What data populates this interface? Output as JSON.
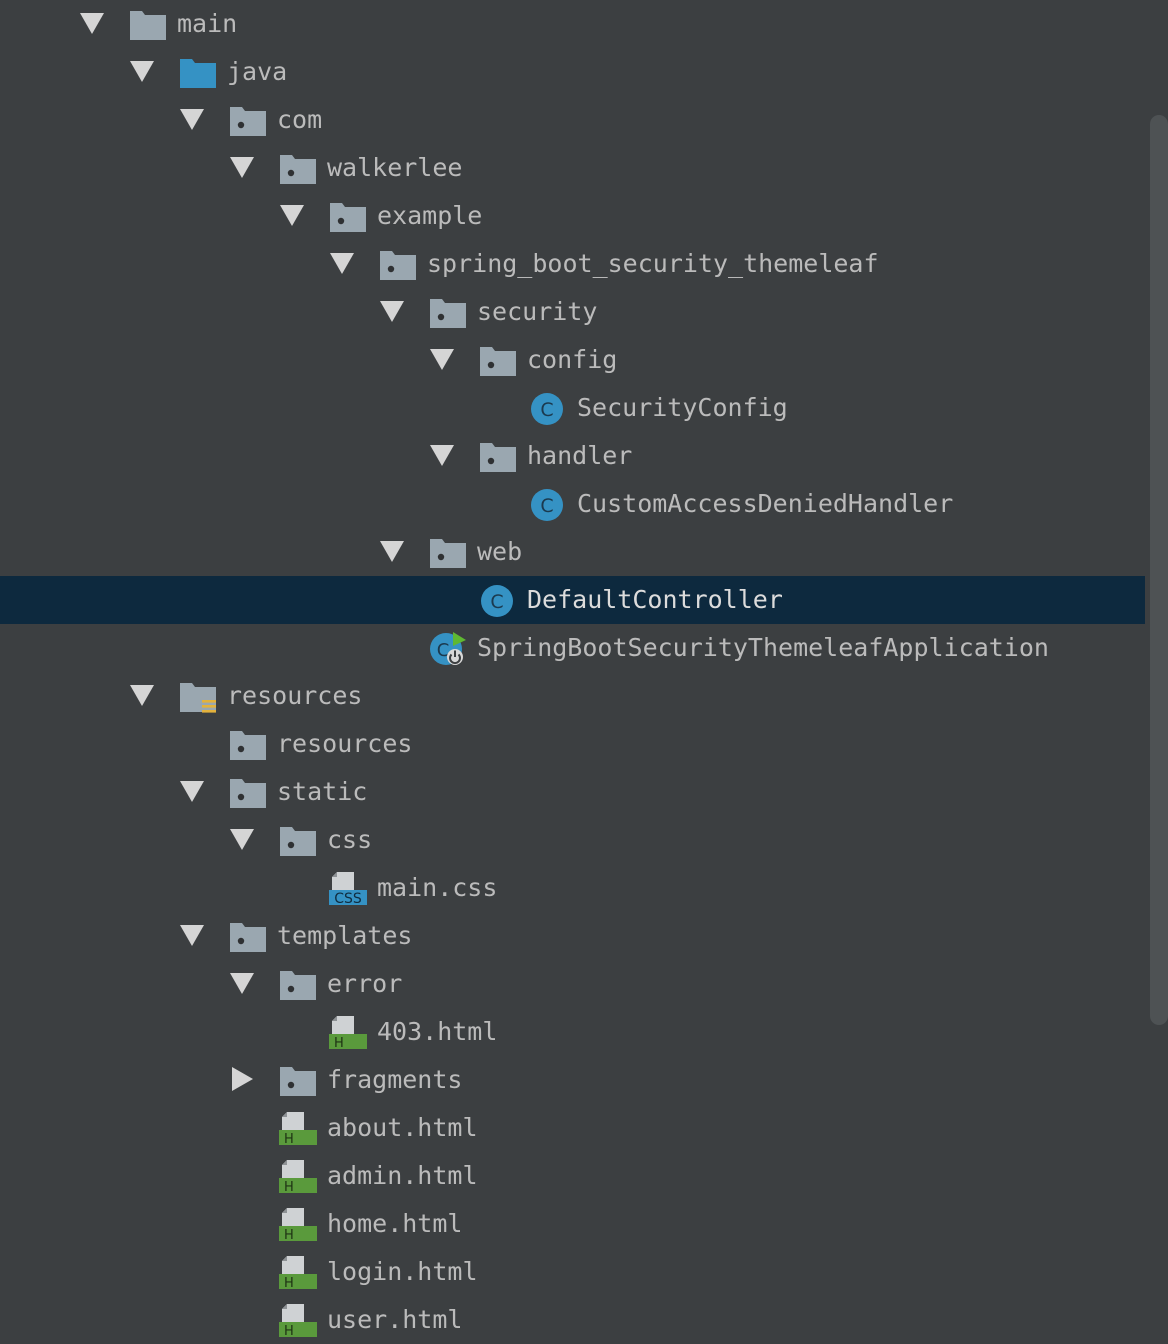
{
  "project_tree": {
    "selected": "DefaultController",
    "items": [
      {
        "label": "main",
        "depth": 0,
        "expanded": true,
        "icon": "folder-icon"
      },
      {
        "label": "java",
        "depth": 1,
        "expanded": true,
        "icon": "source-folder-icon"
      },
      {
        "label": "com",
        "depth": 2,
        "expanded": true,
        "icon": "package-icon"
      },
      {
        "label": "walkerlee",
        "depth": 3,
        "expanded": true,
        "icon": "package-icon"
      },
      {
        "label": "example",
        "depth": 4,
        "expanded": true,
        "icon": "package-icon"
      },
      {
        "label": "spring_boot_security_themeleaf",
        "depth": 5,
        "expanded": true,
        "icon": "package-icon"
      },
      {
        "label": "security",
        "depth": 6,
        "expanded": true,
        "icon": "package-icon"
      },
      {
        "label": "config",
        "depth": 7,
        "expanded": true,
        "icon": "package-icon"
      },
      {
        "label": "SecurityConfig",
        "depth": 8,
        "expanded": null,
        "icon": "java-class-icon"
      },
      {
        "label": "handler",
        "depth": 7,
        "expanded": true,
        "icon": "package-icon"
      },
      {
        "label": "CustomAccessDeniedHandler",
        "depth": 8,
        "expanded": null,
        "icon": "java-class-icon"
      },
      {
        "label": "web",
        "depth": 6,
        "expanded": true,
        "icon": "package-icon"
      },
      {
        "label": "DefaultController",
        "depth": 7,
        "expanded": null,
        "icon": "java-class-icon",
        "selected": true
      },
      {
        "label": "SpringBootSecurityThemeleafApplication",
        "depth": 6,
        "expanded": null,
        "icon": "spring-boot-app-icon"
      },
      {
        "label": "resources",
        "depth": 1,
        "expanded": true,
        "icon": "resources-root-icon"
      },
      {
        "label": "resources",
        "depth": 2,
        "expanded": null,
        "icon": "package-icon"
      },
      {
        "label": "static",
        "depth": 2,
        "expanded": true,
        "icon": "package-icon"
      },
      {
        "label": "css",
        "depth": 3,
        "expanded": true,
        "icon": "package-icon"
      },
      {
        "label": "main.css",
        "depth": 4,
        "expanded": null,
        "icon": "css-file-icon"
      },
      {
        "label": "templates",
        "depth": 2,
        "expanded": true,
        "icon": "package-icon"
      },
      {
        "label": "error",
        "depth": 3,
        "expanded": true,
        "icon": "package-icon"
      },
      {
        "label": "403.html",
        "depth": 4,
        "expanded": null,
        "icon": "html-file-icon"
      },
      {
        "label": "fragments",
        "depth": 3,
        "expanded": false,
        "icon": "package-icon"
      },
      {
        "label": "about.html",
        "depth": 3,
        "expanded": null,
        "icon": "html-file-icon"
      },
      {
        "label": "admin.html",
        "depth": 3,
        "expanded": null,
        "icon": "html-file-icon"
      },
      {
        "label": "home.html",
        "depth": 3,
        "expanded": null,
        "icon": "html-file-icon"
      },
      {
        "label": "login.html",
        "depth": 3,
        "expanded": null,
        "icon": "html-file-icon"
      },
      {
        "label": "user.html",
        "depth": 3,
        "expanded": null,
        "icon": "html-file-icon"
      }
    ]
  },
  "icon_text": {
    "java_class": "C",
    "css_badge": "CSS",
    "html_badge": "H"
  },
  "colors": {
    "background": "#3c3f41",
    "selection": "#0d293e",
    "text": "#bbbbbb",
    "folder": "#9aa7b0",
    "source_folder": "#3592c4",
    "class_circle": "#3592c4",
    "html_badge": "#5a9a3c",
    "css_badge": "#3592c4",
    "spring_green": "#5fb832",
    "resources_marker": "#e3b23c"
  }
}
